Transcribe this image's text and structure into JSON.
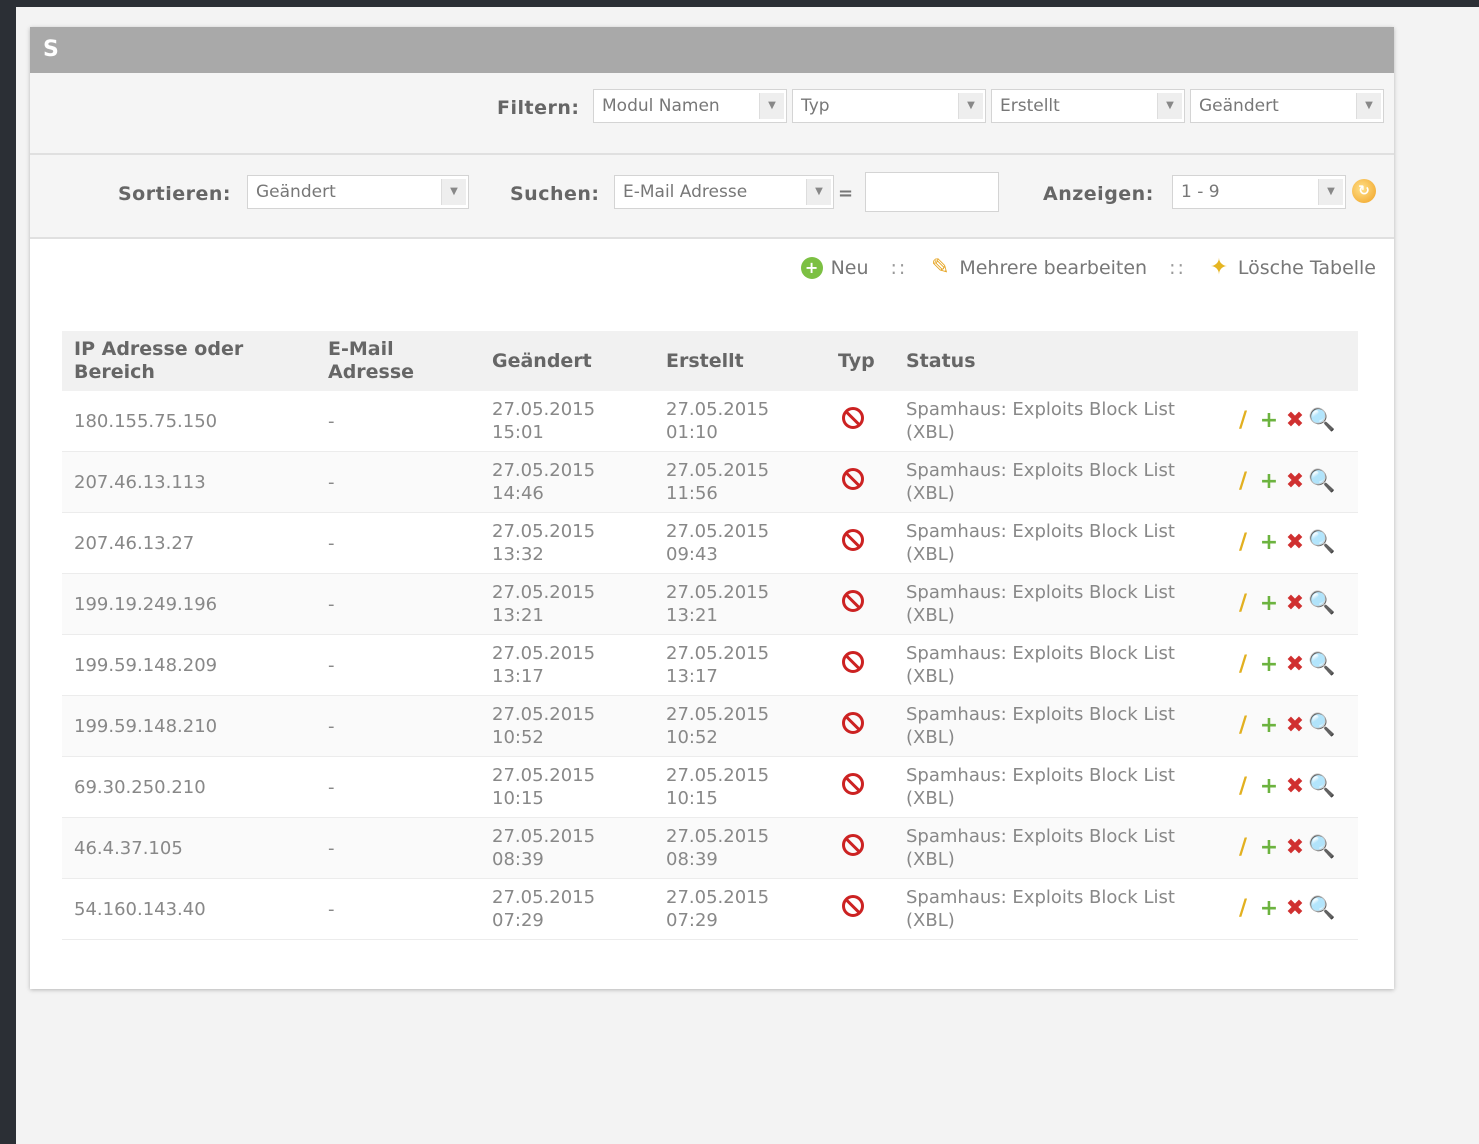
{
  "panel": {
    "title": "S"
  },
  "filter": {
    "label": "Filtern:",
    "selects": [
      {
        "name": "module-names",
        "value": "Modul Namen"
      },
      {
        "name": "type",
        "value": "Typ"
      },
      {
        "name": "created",
        "value": "Erstellt"
      },
      {
        "name": "modified",
        "value": "Geändert"
      }
    ]
  },
  "sort": {
    "label": "Sortieren:",
    "value": "Geändert",
    "search_label": "Suchen:",
    "search_field_value": "E-Mail Adresse",
    "search_dash": "=",
    "search_input_value": "",
    "show_label": "Anzeigen:",
    "show_value": "1 - 9"
  },
  "actions": {
    "new_label": "Neu",
    "multi_label": "Mehrere bearbeiten",
    "clear_label": "Lösche Tabelle",
    "separator": "::"
  },
  "table": {
    "headers": {
      "ip": "IP Adresse oder Bereich",
      "email": "E-Mail Adresse",
      "modified": "Geändert",
      "created": "Erstellt",
      "type": "Typ",
      "status": "Status"
    },
    "rows": [
      {
        "ip": "180.155.75.150",
        "email": "-",
        "modified": "27.05.2015 15:01",
        "created": "27.05.2015 01:10",
        "status": "Spamhaus: Exploits Block List (XBL)"
      },
      {
        "ip": "207.46.13.113",
        "email": "-",
        "modified": "27.05.2015 14:46",
        "created": "27.05.2015 11:56",
        "status": "Spamhaus: Exploits Block List (XBL)"
      },
      {
        "ip": "207.46.13.27",
        "email": "-",
        "modified": "27.05.2015 13:32",
        "created": "27.05.2015 09:43",
        "status": "Spamhaus: Exploits Block List (XBL)"
      },
      {
        "ip": "199.19.249.196",
        "email": "-",
        "modified": "27.05.2015 13:21",
        "created": "27.05.2015 13:21",
        "status": "Spamhaus: Exploits Block List (XBL)"
      },
      {
        "ip": "199.59.148.209",
        "email": "-",
        "modified": "27.05.2015 13:17",
        "created": "27.05.2015 13:17",
        "status": "Spamhaus: Exploits Block List (XBL)"
      },
      {
        "ip": "199.59.148.210",
        "email": "-",
        "modified": "27.05.2015 10:52",
        "created": "27.05.2015 10:52",
        "status": "Spamhaus: Exploits Block List (XBL)"
      },
      {
        "ip": "69.30.250.210",
        "email": "-",
        "modified": "27.05.2015 10:15",
        "created": "27.05.2015 10:15",
        "status": "Spamhaus: Exploits Block List (XBL)"
      },
      {
        "ip": "46.4.37.105",
        "email": "-",
        "modified": "27.05.2015 08:39",
        "created": "27.05.2015 08:39",
        "status": "Spamhaus: Exploits Block List (XBL)"
      },
      {
        "ip": "54.160.143.40",
        "email": "-",
        "modified": "27.05.2015 07:29",
        "created": "27.05.2015 07:29",
        "status": "Spamhaus: Exploits Block List (XBL)"
      }
    ]
  },
  "icons": {
    "new": "plus-circle-icon",
    "multi": "multi-edit-icon",
    "clear": "broom-icon",
    "type": "blocked-icon",
    "row_edit": "pencil-icon",
    "row_add": "plus-icon",
    "row_delete": "delete-icon",
    "row_view": "magnifier-icon",
    "refresh": "refresh-icon"
  },
  "colors": {
    "panel_header": "#a9a9a9",
    "blocked": "#cc2222"
  }
}
